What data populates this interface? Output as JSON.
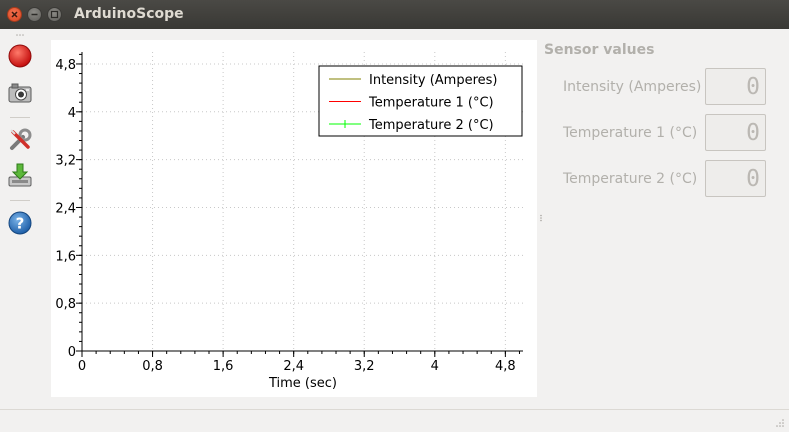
{
  "window": {
    "title": "ArduinoScope"
  },
  "toolbar": {
    "items": [
      {
        "icon": "record-icon",
        "tooltip": ""
      },
      {
        "icon": "camera-icon",
        "tooltip": ""
      },
      {
        "icon": "settings-tools-icon",
        "tooltip": ""
      },
      {
        "icon": "download-icon",
        "tooltip": ""
      },
      {
        "icon": "help-icon",
        "tooltip": ""
      }
    ]
  },
  "chart_data": {
    "type": "line",
    "xlabel": "Time (sec)",
    "ylabel": "",
    "xlim": [
      0,
      5
    ],
    "ylim": [
      0,
      5
    ],
    "x_ticks": [
      "0",
      "0,8",
      "1,6",
      "2,4",
      "3,2",
      "4",
      "4,8"
    ],
    "x_tick_values": [
      0,
      0.8,
      1.6,
      2.4,
      3.2,
      4.0,
      4.8
    ],
    "y_ticks": [
      "0",
      "0,8",
      "1,6",
      "2,4",
      "3,2",
      "4",
      "4,8"
    ],
    "y_tick_values": [
      0,
      0.8,
      1.6,
      2.4,
      3.2,
      4.0,
      4.8
    ],
    "grid": true,
    "legend_position": "top-right",
    "series": [
      {
        "name": "Intensity (Amperes)",
        "color": "#808000",
        "marker": "none",
        "x": [],
        "y": []
      },
      {
        "name": "Temperature 1 (°C)",
        "color": "#ff0000",
        "marker": "none",
        "x": [],
        "y": []
      },
      {
        "name": "Temperature 2 (°C)",
        "color": "#00ff00",
        "marker": "cross",
        "x": [],
        "y": []
      }
    ]
  },
  "sensors": {
    "title": "Sensor values",
    "items": [
      {
        "label": "Intensity (Amperes)",
        "value": "0"
      },
      {
        "label": "Temperature 1 (°C)",
        "value": "0"
      },
      {
        "label": "Temperature 2 (°C)",
        "value": "0"
      }
    ]
  }
}
